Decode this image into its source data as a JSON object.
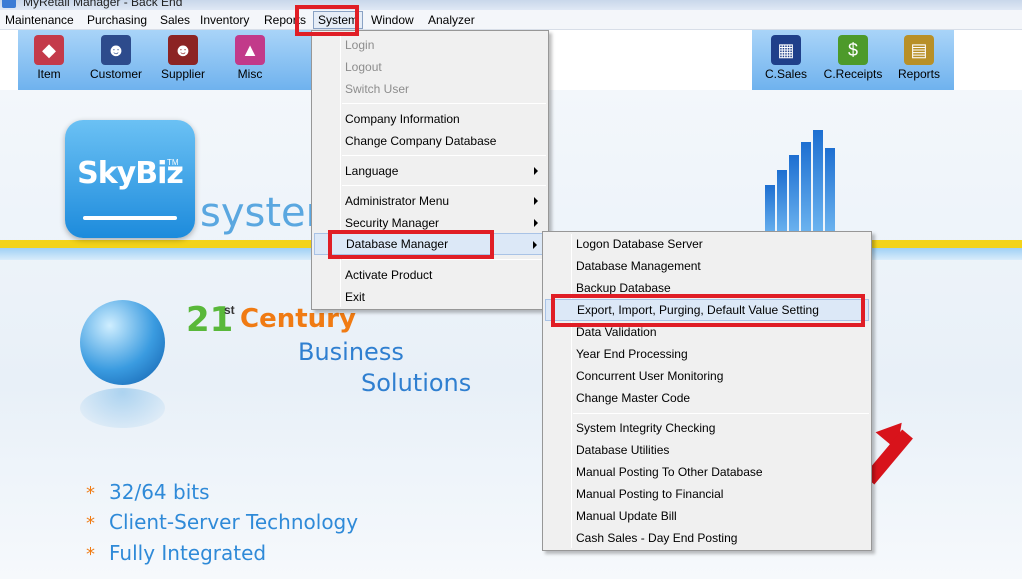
{
  "window": {
    "title": "MyRetail Manager - Back End"
  },
  "menubar": {
    "items": [
      "Maintenance",
      "Purchasing",
      "Sales",
      "Inventory",
      "Reports",
      "System",
      "Window",
      "Analyzer"
    ]
  },
  "toolbar": {
    "left": [
      {
        "label": "Item",
        "icon": "item-icon"
      },
      {
        "label": "Customer",
        "icon": "customer-icon"
      },
      {
        "label": "Supplier",
        "icon": "supplier-icon"
      },
      {
        "label": "Misc",
        "icon": "misc-icon"
      }
    ],
    "right": [
      {
        "label": "C.Sales",
        "icon": "cash-register-icon"
      },
      {
        "label": "C.Receipts",
        "icon": "money-bag-icon"
      },
      {
        "label": "Reports",
        "icon": "reports-icon"
      }
    ]
  },
  "system_menu": {
    "items": [
      {
        "label": "Login",
        "enabled": false
      },
      {
        "label": "Logout",
        "enabled": false
      },
      {
        "label": "Switch User",
        "enabled": false
      },
      {
        "label": "Company Information",
        "enabled": true
      },
      {
        "label": "Change Company Database",
        "enabled": true
      },
      {
        "label": "Language",
        "enabled": true,
        "submenu": true
      },
      {
        "label": "Administrator Menu",
        "enabled": true,
        "submenu": true
      },
      {
        "label": "Security Manager",
        "enabled": true,
        "submenu": true
      },
      {
        "label": "Database Manager",
        "enabled": true,
        "submenu": true,
        "selected": true
      },
      {
        "label": "Activate Product",
        "enabled": true
      },
      {
        "label": "Exit",
        "enabled": true
      }
    ]
  },
  "database_submenu": {
    "items": [
      "Logon Database Server",
      "Database Management",
      "Backup Database",
      "Export, Import, Purging, Default Value Setting",
      "Data Validation",
      "Year End Processing",
      "Concurrent User Monitoring",
      "Change Master Code",
      "System Integrity Checking",
      "Database Utilities",
      "Manual Posting To Other Database",
      "Manual Posting to Financial",
      "Manual Update Bill",
      "Cash Sales - Day End Posting"
    ],
    "selected_index": 3
  },
  "background": {
    "logo_text": "SkyBiz",
    "logo_tm": "TM",
    "logo_suffix": "system",
    "slogan_number": "21",
    "slogan_superscript": "st",
    "slogan_century": "Century",
    "slogan_business": "Business",
    "slogan_solutions": "Solutions",
    "bullets": [
      "32/64 bits",
      "Client-Server Technology",
      "Fully Integrated"
    ]
  },
  "colors": {
    "highlight_box": "#e01e26",
    "toolbar": "#6fb2ee",
    "menu_bg": "#f0f0f0",
    "selected_item": "#dce8f7"
  }
}
